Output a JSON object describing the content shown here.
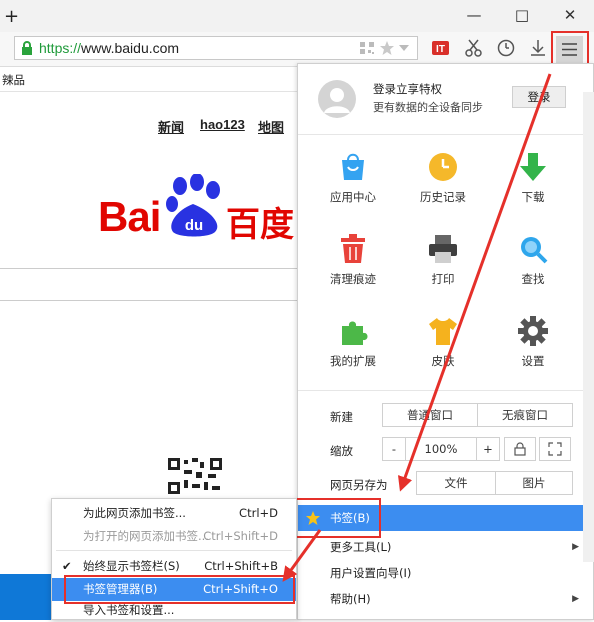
{
  "window": {
    "new_tab": "+",
    "minimize": "—",
    "maximize": "□",
    "close": "✕"
  },
  "address": {
    "url": "https://www.baidu.com"
  },
  "bookmarks_bar": {
    "item": "辣品"
  },
  "page": {
    "links": [
      "新闻",
      "hao123",
      "地图"
    ],
    "logo_latin": "Bai",
    "logo_du": "du",
    "logo_cn": "百度"
  },
  "menu": {
    "login_title": "登录立享特权",
    "login_sub": "更有数据的全设备同步",
    "login_button": "登录",
    "grid": [
      {
        "label": "应用中心",
        "icon": "app-center-icon"
      },
      {
        "label": "历史记录",
        "icon": "history-icon"
      },
      {
        "label": "下载",
        "icon": "download-icon"
      },
      {
        "label": "清理痕迹",
        "icon": "trash-icon"
      },
      {
        "label": "打印",
        "icon": "printer-icon"
      },
      {
        "label": "查找",
        "icon": "magnifier-icon"
      },
      {
        "label": "我的扩展",
        "icon": "puzzle-icon"
      },
      {
        "label": "皮肤",
        "icon": "tshirt-icon"
      },
      {
        "label": "设置",
        "icon": "gear-icon"
      }
    ],
    "new_label": "新建",
    "new_window": "普通窗口",
    "incognito_window": "无痕窗口",
    "zoom_label": "缩放",
    "zoom_minus": "-",
    "zoom_value": "100%",
    "zoom_plus": "+",
    "saveas_label": "网页另存为",
    "saveas_file": "文件",
    "saveas_image": "图片",
    "items": [
      {
        "label": "书签(B)",
        "has_sub": false
      },
      {
        "label": "更多工具(L)",
        "has_sub": true
      },
      {
        "label": "用户设置向导(I)",
        "has_sub": false
      },
      {
        "label": "帮助(H)",
        "has_sub": true
      }
    ]
  },
  "submenu": {
    "items": [
      {
        "label": "为此网页添加书签...",
        "shortcut": "Ctrl+D",
        "disabled": false,
        "checked": false
      },
      {
        "label": "为打开的网页添加书签...",
        "shortcut": "Ctrl+Shift+D",
        "disabled": true,
        "checked": false
      },
      {
        "label": "始终显示书签栏(S)",
        "shortcut": "Ctrl+Shift+B",
        "disabled": false,
        "checked": true
      },
      {
        "label": "书签管理器(B)",
        "shortcut": "Ctrl+Shift+O",
        "disabled": false,
        "checked": false
      },
      {
        "label": "导入书签和设置...",
        "shortcut": "",
        "disabled": false,
        "checked": false
      }
    ]
  },
  "colors": {
    "highlight": "#3c8df0",
    "annotation_red": "#e5302a",
    "baidu_red": "#e10601",
    "baidu_blue": "#2932e1"
  }
}
